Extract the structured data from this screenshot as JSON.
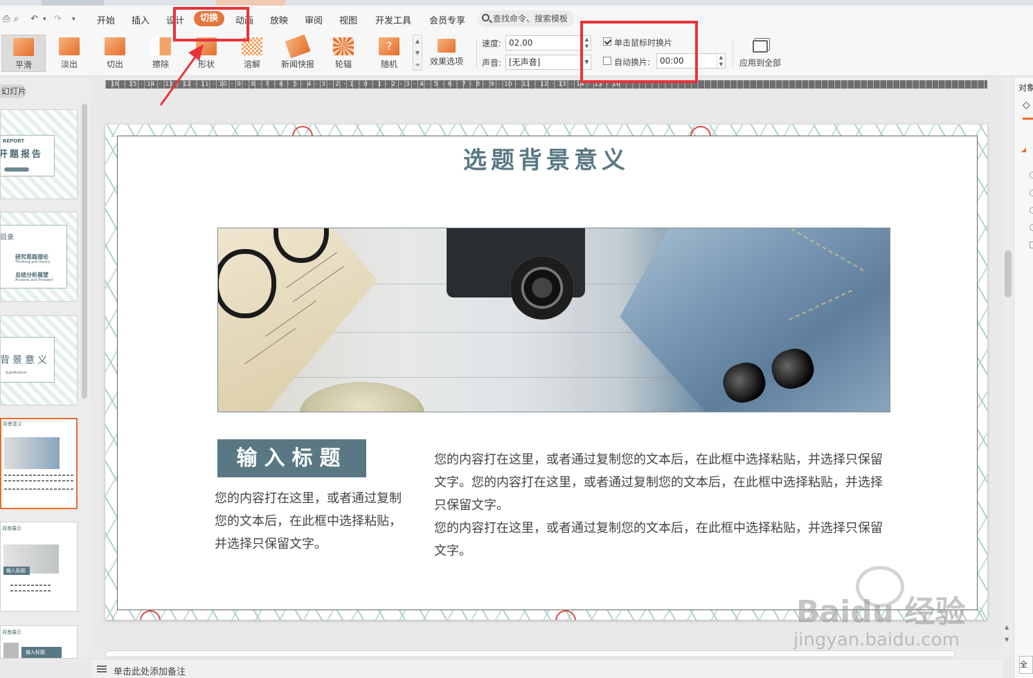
{
  "menu": {
    "items": [
      "开始",
      "插入",
      "设计",
      "切换",
      "动画",
      "放映",
      "审阅",
      "视图",
      "开发工具",
      "会员专享"
    ],
    "active": "切换",
    "search_placeholder": "查找命令、搜索模板"
  },
  "ribbon": {
    "effects": [
      "平滑",
      "淡出",
      "切出",
      "擦除",
      "形状",
      "溶解",
      "新闻快报",
      "轮辐",
      "随机"
    ],
    "effect_options": "效果选项",
    "speed_label": "速度:",
    "speed_value": "02.00",
    "sound_label": "声音:",
    "sound_value": "[无声音]",
    "click_advance_label": "单击鼠标时换片",
    "click_advance_checked": true,
    "auto_advance_label": "自动换片:",
    "auto_advance_checked": false,
    "auto_advance_value": "00:00",
    "apply_all": "应用到全部"
  },
  "left_pane": {
    "tab": "幻灯片",
    "thumbs": [
      {
        "title": "REPORT",
        "sub": "开题报告"
      },
      {
        "title": "目录",
        "item1": "研究思路理论",
        "item1_en": "Thinking and theory",
        "item2": "总结分析展望",
        "item2_en": "Analysis and Prospect"
      },
      {
        "title": "背景意义",
        "sub": "Significance"
      },
      {
        "title": "背景意义"
      },
      {
        "title": "背景展示",
        "box": "输入标题"
      },
      {
        "title": "背景展示",
        "box": "输入标题"
      }
    ]
  },
  "ruler": {
    "labels": "16 · 15 · 14 · 13 · 12 · 11 · 10 · 9 · 8 · 7 · 6 · 5 · 4 · 3 · 2 · 1 · 0 · 1 · 2 · 3 · 4 · 5 · 6 · 7 · 8 · 9 · 10 · 11 · 12 · 13 · 14 · 15 · 16"
  },
  "slide": {
    "title": "选题背景意义",
    "heading": "输入标题",
    "left_text": "您的内容打在这里，或者通过复制您的文本后，在此框中选择粘贴，并选择只保留文字。",
    "right_text_1": "您的内容打在这里，或者通过复制您的文本后，在此框中选择粘贴，并选择只保留文字。您的内容打在这里，或者通过复制您的文本后，在此框中选择粘贴，并选择只保留文字。",
    "right_text_2": "您的内容打在这里，或者通过复制您的文本后，在此框中选择粘贴，并选择只保留文字。"
  },
  "right_pane": {
    "title": "对象属性"
  },
  "status": {
    "notes_placeholder": "单击此处添加备注",
    "corner": "全"
  },
  "watermark": {
    "brand": "Baidu 经验",
    "url": "jingyan.baidu.com"
  },
  "colors": {
    "accent": "#e3763b",
    "annotation": "#e8333a",
    "slide_heading": "#5a7883"
  }
}
